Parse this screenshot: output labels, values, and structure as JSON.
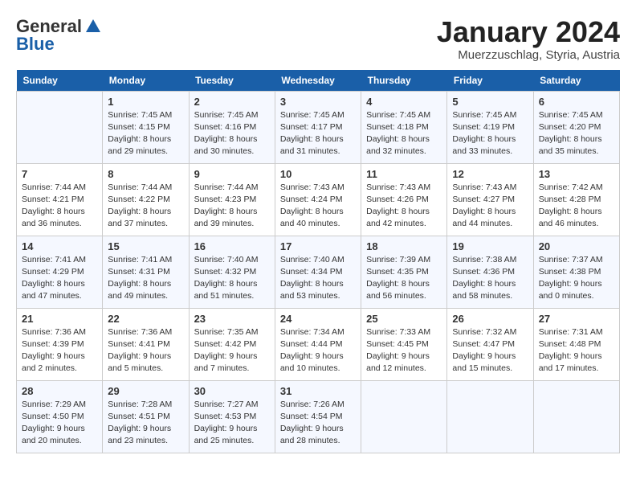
{
  "header": {
    "logo_general": "General",
    "logo_blue": "Blue",
    "month_title": "January 2024",
    "location": "Muerzzuschlag, Styria, Austria"
  },
  "calendar": {
    "days_of_week": [
      "Sunday",
      "Monday",
      "Tuesday",
      "Wednesday",
      "Thursday",
      "Friday",
      "Saturday"
    ],
    "weeks": [
      [
        {
          "day": "",
          "sunrise": "",
          "sunset": "",
          "daylight": ""
        },
        {
          "day": "1",
          "sunrise": "Sunrise: 7:45 AM",
          "sunset": "Sunset: 4:15 PM",
          "daylight": "Daylight: 8 hours and 29 minutes."
        },
        {
          "day": "2",
          "sunrise": "Sunrise: 7:45 AM",
          "sunset": "Sunset: 4:16 PM",
          "daylight": "Daylight: 8 hours and 30 minutes."
        },
        {
          "day": "3",
          "sunrise": "Sunrise: 7:45 AM",
          "sunset": "Sunset: 4:17 PM",
          "daylight": "Daylight: 8 hours and 31 minutes."
        },
        {
          "day": "4",
          "sunrise": "Sunrise: 7:45 AM",
          "sunset": "Sunset: 4:18 PM",
          "daylight": "Daylight: 8 hours and 32 minutes."
        },
        {
          "day": "5",
          "sunrise": "Sunrise: 7:45 AM",
          "sunset": "Sunset: 4:19 PM",
          "daylight": "Daylight: 8 hours and 33 minutes."
        },
        {
          "day": "6",
          "sunrise": "Sunrise: 7:45 AM",
          "sunset": "Sunset: 4:20 PM",
          "daylight": "Daylight: 8 hours and 35 minutes."
        }
      ],
      [
        {
          "day": "7",
          "sunrise": "Sunrise: 7:44 AM",
          "sunset": "Sunset: 4:21 PM",
          "daylight": "Daylight: 8 hours and 36 minutes."
        },
        {
          "day": "8",
          "sunrise": "Sunrise: 7:44 AM",
          "sunset": "Sunset: 4:22 PM",
          "daylight": "Daylight: 8 hours and 37 minutes."
        },
        {
          "day": "9",
          "sunrise": "Sunrise: 7:44 AM",
          "sunset": "Sunset: 4:23 PM",
          "daylight": "Daylight: 8 hours and 39 minutes."
        },
        {
          "day": "10",
          "sunrise": "Sunrise: 7:43 AM",
          "sunset": "Sunset: 4:24 PM",
          "daylight": "Daylight: 8 hours and 40 minutes."
        },
        {
          "day": "11",
          "sunrise": "Sunrise: 7:43 AM",
          "sunset": "Sunset: 4:26 PM",
          "daylight": "Daylight: 8 hours and 42 minutes."
        },
        {
          "day": "12",
          "sunrise": "Sunrise: 7:43 AM",
          "sunset": "Sunset: 4:27 PM",
          "daylight": "Daylight: 8 hours and 44 minutes."
        },
        {
          "day": "13",
          "sunrise": "Sunrise: 7:42 AM",
          "sunset": "Sunset: 4:28 PM",
          "daylight": "Daylight: 8 hours and 46 minutes."
        }
      ],
      [
        {
          "day": "14",
          "sunrise": "Sunrise: 7:41 AM",
          "sunset": "Sunset: 4:29 PM",
          "daylight": "Daylight: 8 hours and 47 minutes."
        },
        {
          "day": "15",
          "sunrise": "Sunrise: 7:41 AM",
          "sunset": "Sunset: 4:31 PM",
          "daylight": "Daylight: 8 hours and 49 minutes."
        },
        {
          "day": "16",
          "sunrise": "Sunrise: 7:40 AM",
          "sunset": "Sunset: 4:32 PM",
          "daylight": "Daylight: 8 hours and 51 minutes."
        },
        {
          "day": "17",
          "sunrise": "Sunrise: 7:40 AM",
          "sunset": "Sunset: 4:34 PM",
          "daylight": "Daylight: 8 hours and 53 minutes."
        },
        {
          "day": "18",
          "sunrise": "Sunrise: 7:39 AM",
          "sunset": "Sunset: 4:35 PM",
          "daylight": "Daylight: 8 hours and 56 minutes."
        },
        {
          "day": "19",
          "sunrise": "Sunrise: 7:38 AM",
          "sunset": "Sunset: 4:36 PM",
          "daylight": "Daylight: 8 hours and 58 minutes."
        },
        {
          "day": "20",
          "sunrise": "Sunrise: 7:37 AM",
          "sunset": "Sunset: 4:38 PM",
          "daylight": "Daylight: 9 hours and 0 minutes."
        }
      ],
      [
        {
          "day": "21",
          "sunrise": "Sunrise: 7:36 AM",
          "sunset": "Sunset: 4:39 PM",
          "daylight": "Daylight: 9 hours and 2 minutes."
        },
        {
          "day": "22",
          "sunrise": "Sunrise: 7:36 AM",
          "sunset": "Sunset: 4:41 PM",
          "daylight": "Daylight: 9 hours and 5 minutes."
        },
        {
          "day": "23",
          "sunrise": "Sunrise: 7:35 AM",
          "sunset": "Sunset: 4:42 PM",
          "daylight": "Daylight: 9 hours and 7 minutes."
        },
        {
          "day": "24",
          "sunrise": "Sunrise: 7:34 AM",
          "sunset": "Sunset: 4:44 PM",
          "daylight": "Daylight: 9 hours and 10 minutes."
        },
        {
          "day": "25",
          "sunrise": "Sunrise: 7:33 AM",
          "sunset": "Sunset: 4:45 PM",
          "daylight": "Daylight: 9 hours and 12 minutes."
        },
        {
          "day": "26",
          "sunrise": "Sunrise: 7:32 AM",
          "sunset": "Sunset: 4:47 PM",
          "daylight": "Daylight: 9 hours and 15 minutes."
        },
        {
          "day": "27",
          "sunrise": "Sunrise: 7:31 AM",
          "sunset": "Sunset: 4:48 PM",
          "daylight": "Daylight: 9 hours and 17 minutes."
        }
      ],
      [
        {
          "day": "28",
          "sunrise": "Sunrise: 7:29 AM",
          "sunset": "Sunset: 4:50 PM",
          "daylight": "Daylight: 9 hours and 20 minutes."
        },
        {
          "day": "29",
          "sunrise": "Sunrise: 7:28 AM",
          "sunset": "Sunset: 4:51 PM",
          "daylight": "Daylight: 9 hours and 23 minutes."
        },
        {
          "day": "30",
          "sunrise": "Sunrise: 7:27 AM",
          "sunset": "Sunset: 4:53 PM",
          "daylight": "Daylight: 9 hours and 25 minutes."
        },
        {
          "day": "31",
          "sunrise": "Sunrise: 7:26 AM",
          "sunset": "Sunset: 4:54 PM",
          "daylight": "Daylight: 9 hours and 28 minutes."
        },
        {
          "day": "",
          "sunrise": "",
          "sunset": "",
          "daylight": ""
        },
        {
          "day": "",
          "sunrise": "",
          "sunset": "",
          "daylight": ""
        },
        {
          "day": "",
          "sunrise": "",
          "sunset": "",
          "daylight": ""
        }
      ]
    ]
  }
}
